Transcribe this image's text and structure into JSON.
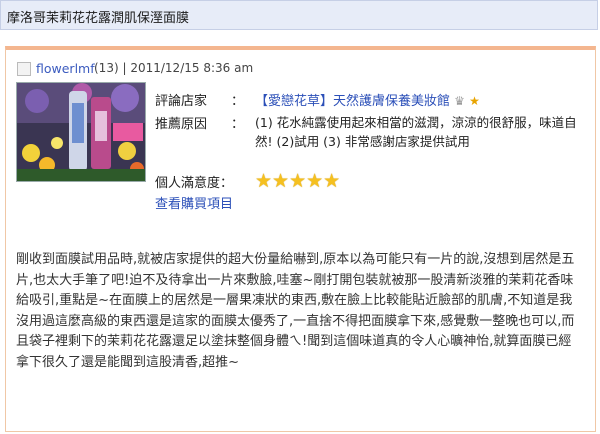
{
  "page_title": "摩洛哥茉莉花花露潤肌保溼面膜",
  "post": {
    "username": "flowerlmf",
    "user_count": "(13)",
    "separator": "|",
    "datetime": "2011/12/15  8:36 am",
    "labels": {
      "store": "評論店家",
      "reason": "推薦原因",
      "satisfaction": "個人滿意度："
    },
    "colon": "：",
    "store_name": "【愛戀花草】天然護膚保養美妝館",
    "reason_text": "(1) 花水純露使用起來相當的滋潤，涼涼的很舒服，味道自然!  (2)試用  (3) 非常感謝店家提供試用",
    "stars": "★★★★★",
    "rating": 5,
    "rating_max": 5,
    "view_items_link": "查看購買項目",
    "review_text": "剛收到面膜試用品時,就被店家提供的超大份量給嚇到,原本以為可能只有一片的說,沒想到居然是五片,也太大手筆了吧!迫不及待拿出一片來敷臉,哇塞~剛打開包裝就被那一股清新淡雅的茉莉花香味給吸引,重點是~在面膜上的居然是一層果凍狀的東西,敷在臉上比較能貼近臉部的肌膚,不知道是我沒用過這麼高級的東西還是這家的面膜太優秀了,一直捨不得把面膜拿下來,感覺敷一整晚也可以,而且袋子裡剩下的茉莉花花露還足以塗抹整個身體ㄟ!聞到這個味道真的令人心曠神怡,就算面膜已經拿下很久了還是能聞到這股清香,超推~"
  },
  "colors": {
    "link": "#2b4fb8",
    "star": "#f5c020",
    "card_border": "#f4b68f",
    "titlebar_bg": "#e7ecf8"
  }
}
